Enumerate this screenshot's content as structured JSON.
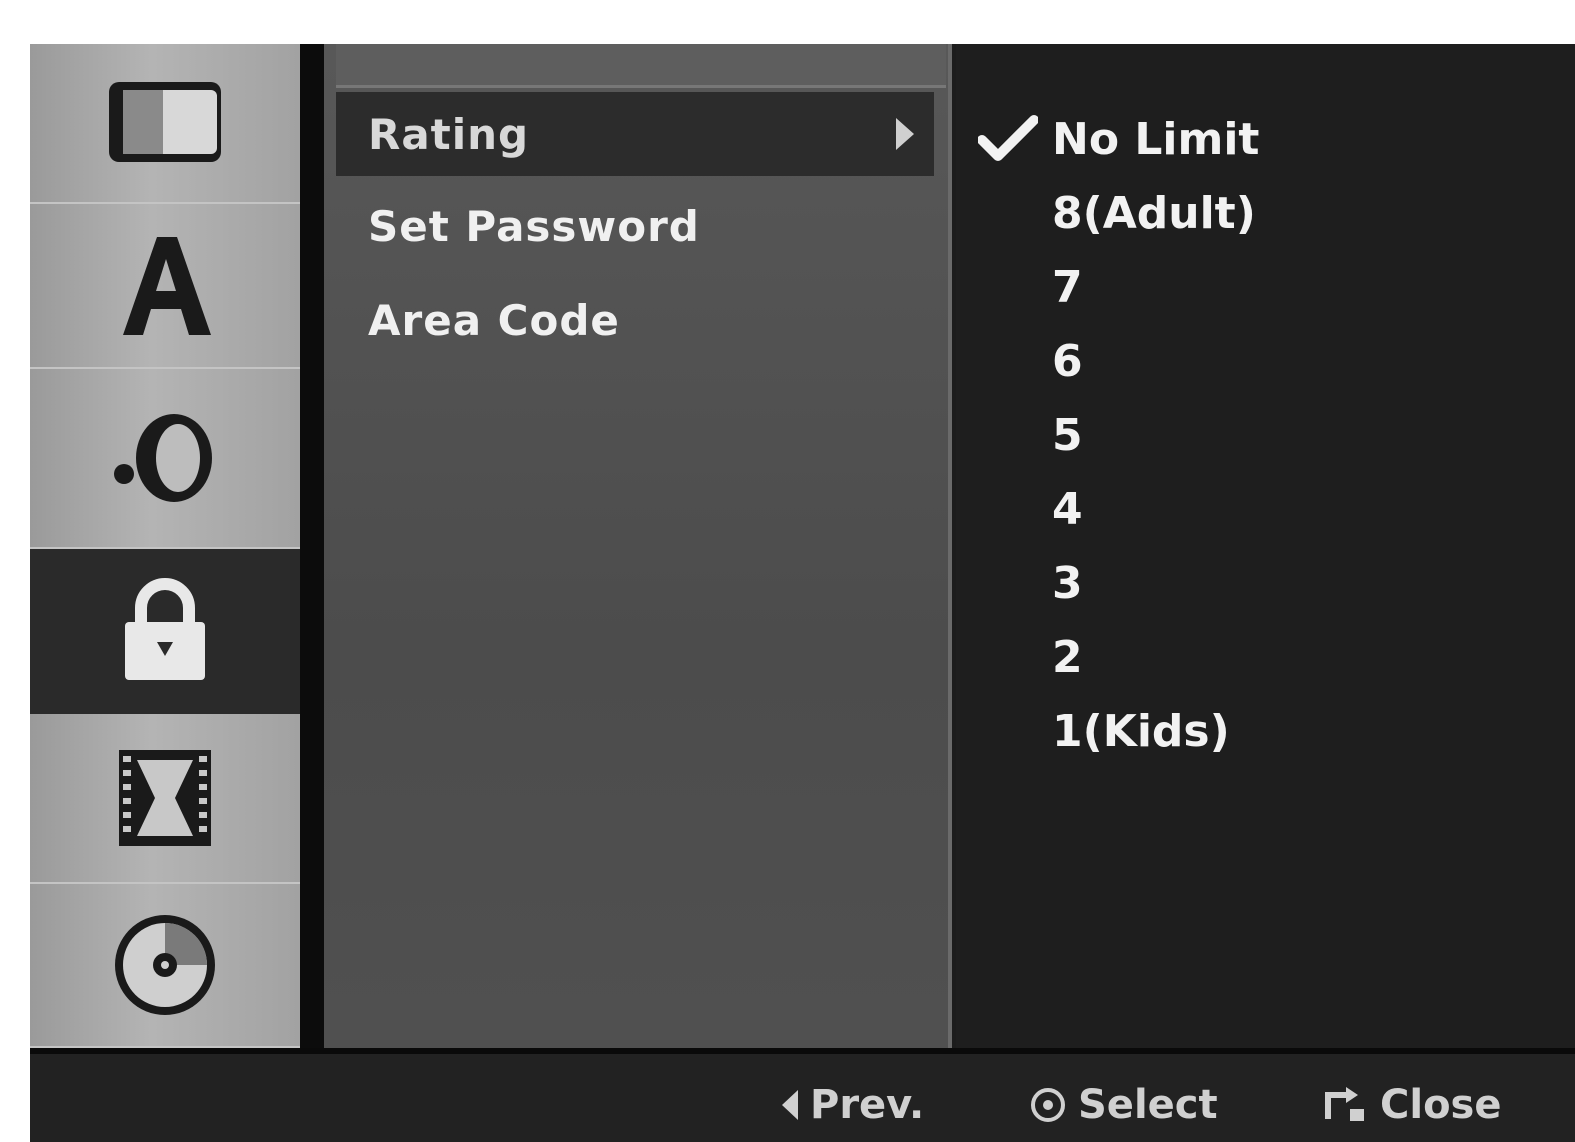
{
  "sidebar": {
    "categories": [
      {
        "icon": "tv-screen-icon",
        "selected": false
      },
      {
        "icon": "language-letter-a-icon",
        "selected": false
      },
      {
        "icon": "speaker-audio-icon",
        "selected": false
      },
      {
        "icon": "lock-icon",
        "selected": true
      },
      {
        "icon": "film-strip-icon",
        "selected": false
      },
      {
        "icon": "disc-icon",
        "selected": false
      }
    ]
  },
  "submenu": {
    "items": [
      {
        "label": "Rating",
        "selected": true
      },
      {
        "label": "Set Password",
        "selected": false
      },
      {
        "label": "Area Code",
        "selected": false
      }
    ]
  },
  "options": {
    "checked_index": 0,
    "items": [
      "No Limit",
      "8(Adult)",
      "7",
      "6",
      "5",
      "4",
      "3",
      "2",
      "1(Kids)"
    ]
  },
  "footer": {
    "prev_label": "Prev.",
    "select_label": "Select",
    "close_label": "Close"
  }
}
